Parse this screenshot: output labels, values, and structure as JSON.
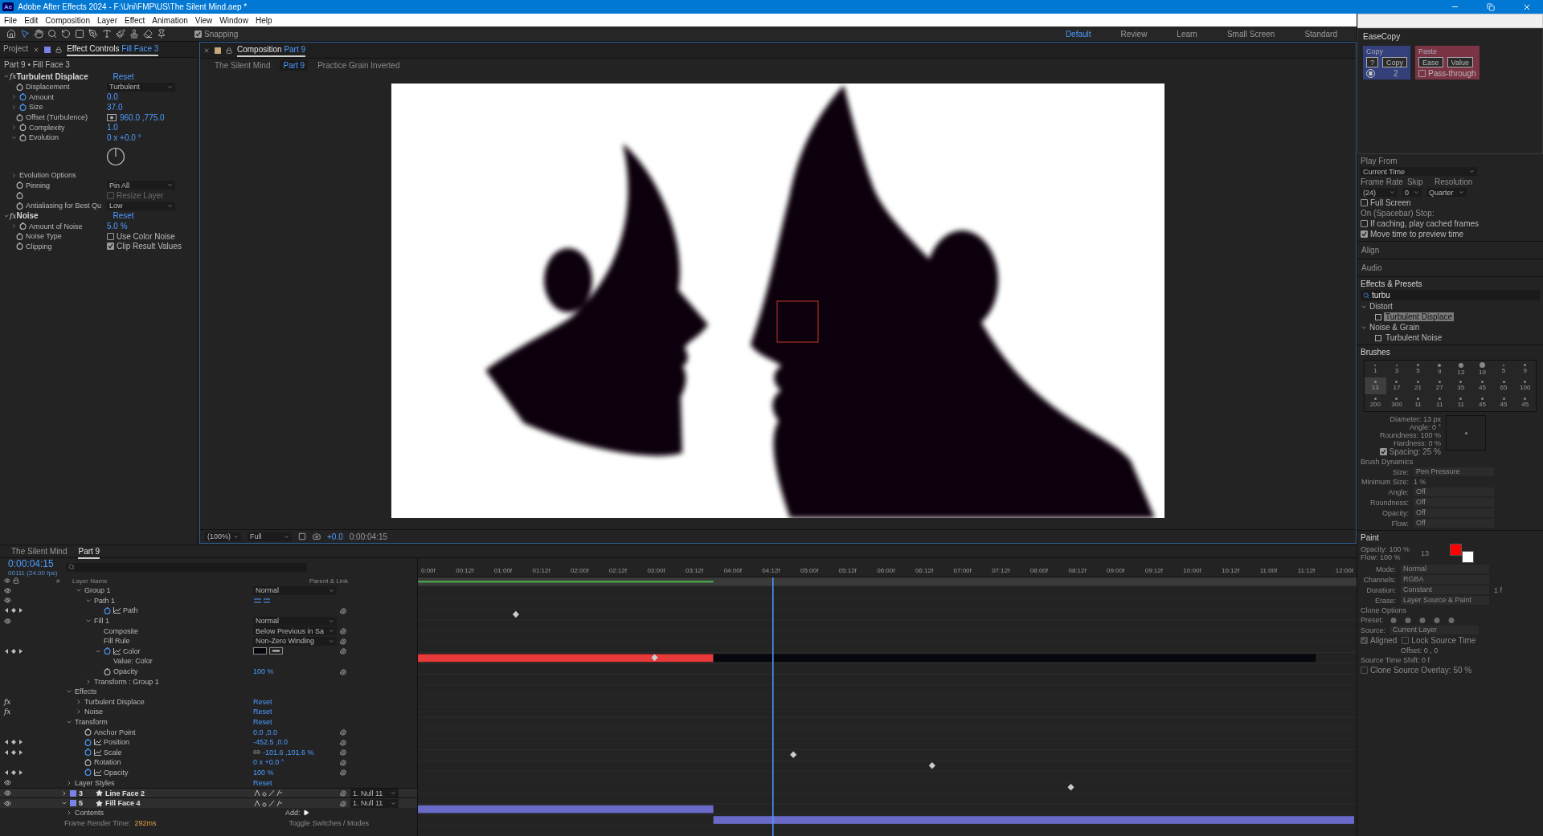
{
  "window": {
    "app_icon": "Ae",
    "title": "Adobe After Effects 2024 - F:\\Uni\\FMP\\US\\The Silent Mind.aep *"
  },
  "menu": [
    "File",
    "Edit",
    "Composition",
    "Layer",
    "Effect",
    "Animation",
    "View",
    "Window",
    "Help"
  ],
  "toolbar": {
    "snapping": {
      "label": "Snapping",
      "checked": true
    },
    "workspaces": [
      {
        "label": "Default",
        "selected": true
      },
      {
        "label": "Review",
        "selected": false
      },
      {
        "label": "Learn",
        "selected": false
      },
      {
        "label": "Small Screen",
        "selected": false
      },
      {
        "label": "Standard",
        "selected": false
      }
    ]
  },
  "effect_controls": {
    "project_tab": "Project",
    "tab_title": "Effect Controls",
    "tab_layer": "Fill Face 3",
    "header": "Part 9 • Fill Face 3",
    "effects": [
      {
        "fx": "fx",
        "name": "Turbulent Displace",
        "reset": "Reset",
        "expanded": true,
        "params": [
          {
            "kind": "dropdown",
            "label": "Displacement",
            "value": "Turbulent"
          },
          {
            "kind": "value",
            "label": "Amount",
            "value": "0.0",
            "animated": true
          },
          {
            "kind": "value",
            "label": "Size",
            "value": "37.0",
            "animated": true
          },
          {
            "kind": "point",
            "label": "Offset (Turbulence)",
            "value": "960.0 ,775.0",
            "animated": false
          },
          {
            "kind": "value",
            "label": "Complexity",
            "value": "1.0",
            "animated": false
          },
          {
            "kind": "dial",
            "label": "Evolution",
            "value": "0 x +0.0 °",
            "animated": false
          },
          {
            "kind": "group",
            "label": "Evolution Options"
          },
          {
            "kind": "dropdown",
            "label": "Pinning",
            "value": "Pin All"
          },
          {
            "kind": "checkbox",
            "value": "Resize Layer",
            "checked": false,
            "disabled": true
          },
          {
            "kind": "dropdown",
            "label": "Antialiasing for Best Qu",
            "value": "Low"
          }
        ]
      },
      {
        "fx": "fx",
        "name": "Noise",
        "reset": "Reset",
        "expanded": true,
        "params": [
          {
            "kind": "value",
            "label": "Amount of Noise",
            "value": "5.0 %",
            "animated": false
          },
          {
            "kind": "checkbox",
            "label": "Noise Type",
            "value": "Use Color Noise",
            "checked": false,
            "disabled": false
          },
          {
            "kind": "checkbox",
            "label": "Clipping",
            "value": "Clip Result Values",
            "checked": true,
            "disabled": false
          }
        ]
      }
    ]
  },
  "composition": {
    "tab_title": "Composition",
    "tab_comp": "Part 9",
    "breadcrumbs": [
      {
        "label": "The Silent Mind",
        "selected": false
      },
      {
        "label": "Part 9",
        "selected": true
      },
      {
        "label": "Practice Grain Inverted",
        "selected": false
      }
    ],
    "footer": {
      "zoom": "(100%)",
      "resolution": "Full",
      "exposure": "+0.0",
      "timecode": "0:00:04:15"
    }
  },
  "easecopy": {
    "title": "EaseCopy",
    "copy_label": "Copy",
    "help_button": "?",
    "copy_button": "Copy",
    "count": "2",
    "paste_label": "Paste",
    "ease_button": "Ease",
    "value_button": "Value",
    "pass_through": {
      "label": "Pass-through",
      "checked": false
    }
  },
  "preview": {
    "play_from_label": "Play From",
    "play_from": "Current Time",
    "frame_rate_label": "Frame Rate",
    "skip_label": "Skip",
    "resolution_label": "Resolution",
    "frame_rate": "(24)",
    "skip": "0",
    "resolution": "Quarter",
    "full_screen": {
      "label": "Full Screen",
      "checked": false
    },
    "stop_label": "On (Spacebar) Stop:",
    "stop_options": [
      {
        "label": "If caching, play cached frames",
        "checked": false
      },
      {
        "label": "Move time to preview time",
        "checked": true
      }
    ]
  },
  "collapsed_panels": [
    "Align",
    "Audio"
  ],
  "effects_presets": {
    "title": "Effects & Presets",
    "search": "turbu",
    "tree": [
      {
        "label": "Distort",
        "expanded": true,
        "children": [
          {
            "label": "Turbulent Displace",
            "selected": true
          }
        ]
      },
      {
        "label": "Noise & Grain",
        "expanded": true,
        "children": [
          {
            "label": "Turbulent Noise",
            "selected": false
          }
        ]
      }
    ]
  },
  "brushes": {
    "title": "Brushes",
    "tips": [
      {
        "label": "1",
        "selected": false
      },
      {
        "label": "3",
        "selected": false
      },
      {
        "label": "5",
        "selected": false
      },
      {
        "label": "9",
        "selected": false
      },
      {
        "label": "13",
        "selected": false
      },
      {
        "label": "19",
        "selected": false
      },
      {
        "label": "5",
        "selected": false
      },
      {
        "label": "9",
        "selected": false
      },
      {
        "label": "13",
        "selected": true
      },
      {
        "label": "17",
        "selected": false
      },
      {
        "label": "21",
        "selected": false
      },
      {
        "label": "27",
        "selected": false
      },
      {
        "label": "35",
        "selected": false
      },
      {
        "label": "45",
        "selected": false
      },
      {
        "label": "65",
        "selected": false
      },
      {
        "label": "100",
        "selected": false
      },
      {
        "label": "200",
        "selected": false
      },
      {
        "label": "300",
        "selected": false
      },
      {
        "label": "11",
        "selected": false
      },
      {
        "label": "11",
        "selected": false
      },
      {
        "label": "11",
        "selected": false
      },
      {
        "label": "45",
        "selected": false
      },
      {
        "label": "45",
        "selected": false
      },
      {
        "label": "45",
        "selected": false
      }
    ],
    "properties": [
      "Diameter: 13 px",
      "Angle: 0 °",
      "Roundness: 100 %",
      "Hardness: 0 %"
    ],
    "spacing": {
      "label": "Spacing: 25 %",
      "checked": true
    },
    "dynamics_title": "Brush Dynamics",
    "dynamics": [
      {
        "kind": "dropdown",
        "label": "Size:",
        "value": "Pen Pressure"
      },
      {
        "kind": "text",
        "label": "Minimum Size:",
        "value": "1 %"
      },
      {
        "kind": "dropdown",
        "label": "Angle:",
        "value": "Off"
      },
      {
        "kind": "dropdown",
        "label": "Roundness:",
        "value": "Off"
      },
      {
        "kind": "dropdown",
        "label": "Opacity:",
        "value": "Off"
      },
      {
        "kind": "dropdown",
        "label": "Flow:",
        "value": "Off"
      }
    ]
  },
  "paint": {
    "title": "Paint",
    "opacity": "Opacity: 100 %",
    "flow": "Flow: 100 %",
    "brush_tip": "13",
    "swatches": [
      {
        "color": "#ff0000"
      },
      {
        "color": "#ffffff"
      }
    ],
    "fields": [
      {
        "label": "Mode:",
        "value": "Normal"
      },
      {
        "label": "Channels:",
        "value": "RGBA"
      },
      {
        "label": "Duration:",
        "value": "Constant"
      },
      {
        "label": "Erase:",
        "value": "Layer Source & Paint"
      }
    ],
    "duration_extra": "1 f",
    "clone_title": "Clone Options",
    "preset_label": "Preset:",
    "source_label": "Source:",
    "source": "Current Layer",
    "aligned": {
      "label": "Aligned",
      "checked": true
    },
    "lock_source_time": {
      "label": "Lock Source Time",
      "checked": false
    },
    "offset": "Offset: 0 ,     0",
    "time_shift": "Source Time Shift: 0 f",
    "overlay": {
      "label": "Clone Source Overlay:",
      "value": "50 %",
      "checked": false
    }
  },
  "timeline": {
    "tabs": [
      {
        "label": "The Silent Mind",
        "selected": false
      },
      {
        "label": "Part 9",
        "selected": true
      }
    ],
    "timecode": "0:00:04:15",
    "frame_info": "00111 (24.00 fps)",
    "col_number": "#",
    "col_name": "Layer Name",
    "col_parent": "Parent & Link",
    "ruler": [
      "0:00f",
      "00:12f",
      "01:00f",
      "01:12f",
      "02:00f",
      "02:12f",
      "03:00f",
      "03:12f",
      "04:00f",
      "04:12f",
      "05:00f",
      "05:12f",
      "06:00f",
      "06:12f",
      "07:00f",
      "07:12f",
      "08:00f",
      "08:12f",
      "09:00f",
      "09:12f",
      "10:00f",
      "10:12f",
      "11:00f",
      "11:12f",
      "12:00f"
    ],
    "rows": [
      {
        "kind": "hidden",
        "children": [
          {
            "kind": "hidden",
            "children": [
              {
                "label": "Group 1",
                "expanded": true,
                "visible": true,
                "value": {
                  "kind": "dropdown",
                  "text": "Normal"
                },
                "children": [
                  {
                    "label": "Path 1",
                    "expanded": true,
                    "visible": true,
                    "value": {
                      "kind": "direction"
                    },
                    "children": [
                      {
                        "label": "Path",
                        "stopwatch": true,
                        "keyframes": true,
                        "link": true
                      }
                    ]
                  },
                  {
                    "label": "Fill 1",
                    "expanded": true,
                    "visible": true,
                    "value": {
                      "kind": "dropdown",
                      "text": "Normal"
                    },
                    "children": [
                      {
                        "label": "Composite",
                        "value": {
                          "kind": "dropdown",
                          "text": "Below Previous in Sa"
                        },
                        "link": true
                      },
                      {
                        "label": "Fill Rule",
                        "value": {
                          "kind": "dropdown",
                          "text": "Non-Zero Winding"
                        },
                        "link": true
                      },
                      {
                        "label": "Color",
                        "expanded": true,
                        "stopwatch": true,
                        "keyframes": true,
                        "value": {
                          "kind": "swatch"
                        },
                        "link": true,
                        "children": [
                          {
                            "label": "Value: Color"
                          }
                        ]
                      },
                      {
                        "label": "Opacity",
                        "stopwatch": false,
                        "value": {
                          "kind": "text",
                          "text": "100 %"
                        },
                        "link": true
                      }
                    ]
                  },
                  {
                    "label": "Transform : Group 1",
                    "expanded": false
                  }
                ]
              }
            ]
          },
          {
            "label": "Effects",
            "expanded": true,
            "children": [
              {
                "kind": "effect",
                "fx": "fx",
                "label": "Turbulent Displace",
                "expanded": false,
                "value": {
                  "kind": "reset",
                  "text": "Reset"
                }
              },
              {
                "kind": "effect",
                "fx": "fx",
                "label": "Noise",
                "expanded": false,
                "value": {
                  "kind": "reset",
                  "text": "Reset"
                }
              }
            ]
          },
          {
            "label": "Transform",
            "expanded": true,
            "value": {
              "kind": "reset",
              "text": "Reset"
            },
            "children": [
              {
                "label": "Anchor Point",
                "stopwatch": false,
                "value": {
                  "kind": "text",
                  "text": "0.0 ,0.0"
                },
                "link": true
              },
              {
                "label": "Position",
                "stopwatch": true,
                "keyframes": true,
                "value": {
                  "kind": "text",
                  "text": "-452.5 ,0.0"
                },
                "link": true
              },
              {
                "label": "Scale",
                "stopwatch": true,
                "keyframes": true,
                "value": {
                  "kind": "scale",
                  "text": "-101.6 ,101.6 %"
                },
                "link": true
              },
              {
                "label": "Rotation",
                "stopwatch": false,
                "value": {
                  "kind": "text",
                  "text": "0 x +0.0 °"
                },
                "link": true
              },
              {
                "label": "Opacity",
                "stopwatch": true,
                "keyframes": true,
                "value": {
                  "kind": "text",
                  "text": "100 %"
                },
                "link": true
              }
            ]
          },
          {
            "label": "Layer Styles",
            "expanded": false,
            "visible": true,
            "value": {
              "kind": "reset",
              "text": "Reset"
            }
          }
        ]
      },
      {
        "kind": "layer",
        "number": "3",
        "label": "Line Face 2",
        "expanded": false,
        "visible": true,
        "parent": "1. Null 11"
      },
      {
        "kind": "layer",
        "number": "5",
        "label": "Fill Face 4",
        "expanded": true,
        "visible": true,
        "parent": "1. Null 11",
        "children": [
          {
            "label": "Contents",
            "expanded": false,
            "add_label": "Add:"
          }
        ]
      }
    ],
    "footer": {
      "render_label": "Frame Render Time:",
      "render_time": "292ms",
      "toggle": "Toggle Switches / Modes"
    }
  }
}
